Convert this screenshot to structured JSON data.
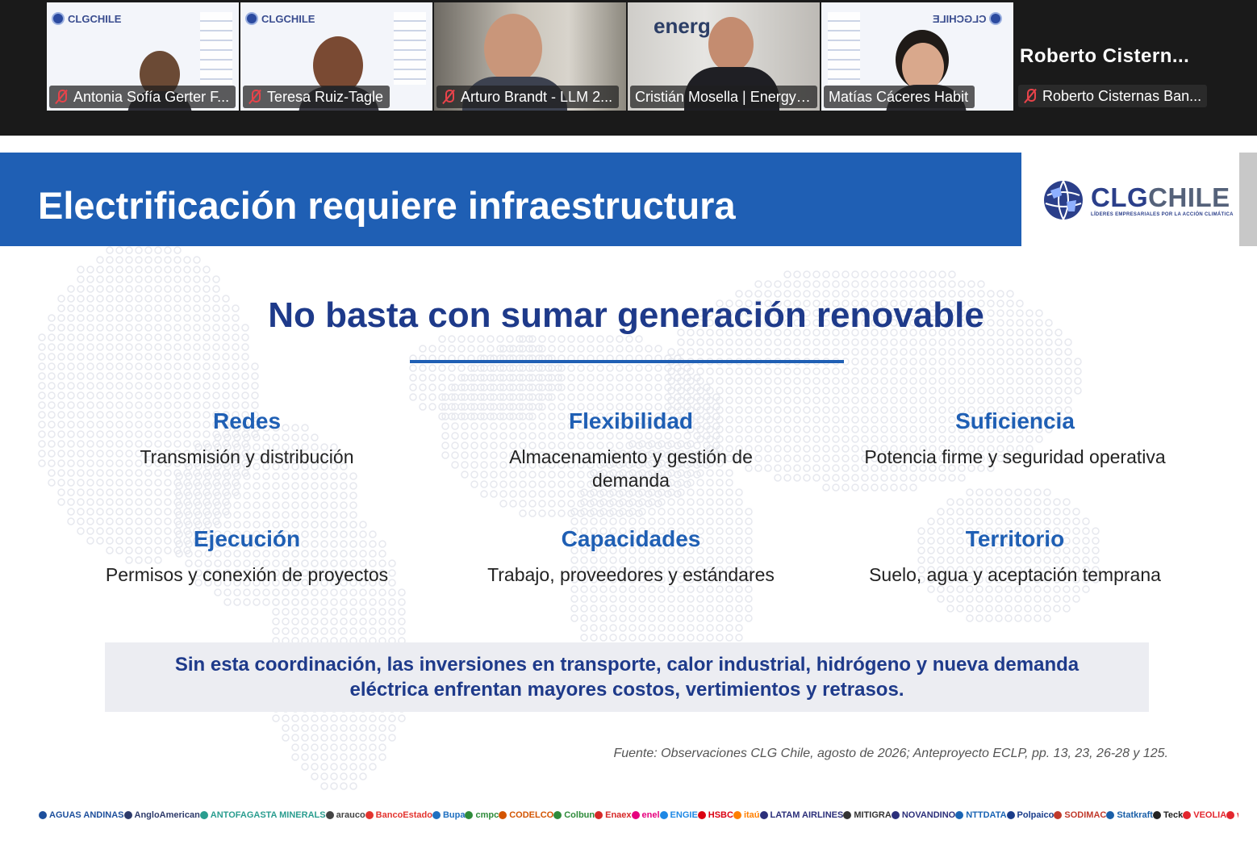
{
  "participants": [
    {
      "name": "Antonia Sofía Gerter F...",
      "muted": true,
      "bg": "logo"
    },
    {
      "name": "Teresa Ruiz-Tagle",
      "muted": true,
      "bg": "logo"
    },
    {
      "name": "Arturo Brandt - LLM 2...",
      "muted": true,
      "bg": "room"
    },
    {
      "name": "Cristián Mosella | EnergyL...",
      "muted": false,
      "bg": "office",
      "bg_text": "energ"
    },
    {
      "name": "Matías Cáceres Habit",
      "muted": false,
      "bg": "logo-mirrored",
      "speaking": true
    }
  ],
  "participant_logo_text": "CLGCHILE",
  "presenter_display_name": "Roberto  Cistern...",
  "presenter_bar_name": "Roberto Cisternas Ban...",
  "slide": {
    "title": "Electrificación requiere infraestructura",
    "logo": {
      "word_a": "CLG",
      "word_b": "CHILE",
      "tagline": "LÍDERES EMPRESARIALES POR LA ACCIÓN CLIMÁTICA"
    },
    "subtitle": "No basta con sumar generación renovable",
    "items": [
      {
        "head": "Redes",
        "desc": "Transmisión y distribución"
      },
      {
        "head": "Flexibilidad",
        "desc": "Almacenamiento y gestión de demanda"
      },
      {
        "head": "Suficiencia",
        "desc": "Potencia firme y seguridad operativa"
      },
      {
        "head": "Ejecución",
        "desc": "Permisos y conexión de proyectos"
      },
      {
        "head": "Capacidades",
        "desc": "Trabajo, proveedores y estándares"
      },
      {
        "head": "Territorio",
        "desc": "Suelo, agua y aceptación temprana"
      }
    ],
    "callout": "Sin esta coordinación, las inversiones en transporte, calor industrial, hidrógeno y nueva demanda eléctrica enfrentan mayores costos, vertimientos y retrasos.",
    "source": "Fuente: Observaciones CLG Chile, agosto de 2026; Anteproyecto ECLP, pp. 13, 23, 26-28 y 125."
  },
  "sponsors": [
    {
      "name": "AGUAS ANDINAS",
      "color": "#1d4f9c"
    },
    {
      "name": "AngloAmerican",
      "color": "#2d3a6a"
    },
    {
      "name": "ANTOFAGASTA MINERALS",
      "color": "#2a9d8f"
    },
    {
      "name": "arauco",
      "color": "#444444"
    },
    {
      "name": "BancoEstado",
      "color": "#e3342f"
    },
    {
      "name": "Bupa",
      "color": "#1e6fc0"
    },
    {
      "name": "cmpc",
      "color": "#2e8b3a"
    },
    {
      "name": "CODELCO",
      "color": "#d35400"
    },
    {
      "name": "Colbun",
      "color": "#2e8b3a"
    },
    {
      "name": "Enaex",
      "color": "#d62828"
    },
    {
      "name": "enel",
      "color": "#e6007e"
    },
    {
      "name": "ENGIE",
      "color": "#1e88e5"
    },
    {
      "name": "HSBC",
      "color": "#db0011"
    },
    {
      "name": "itaú",
      "color": "#ff7f00"
    },
    {
      "name": "LATAM AIRLINES",
      "color": "#2b2f7a"
    },
    {
      "name": "MITIGRA",
      "color": "#333333"
    },
    {
      "name": "NOVANDINO",
      "color": "#2b2f7a"
    },
    {
      "name": "NTTDATA",
      "color": "#1a64b4"
    },
    {
      "name": "Polpaico",
      "color": "#1a3c8a"
    },
    {
      "name": "SODIMAC",
      "color": "#c0392b"
    },
    {
      "name": "Statkraft",
      "color": "#1a5fa8"
    },
    {
      "name": "Teck",
      "color": "#222222"
    },
    {
      "name": "VEOLIA",
      "color": "#e3262e"
    },
    {
      "name": "wsp",
      "color": "#e3262e"
    }
  ]
}
